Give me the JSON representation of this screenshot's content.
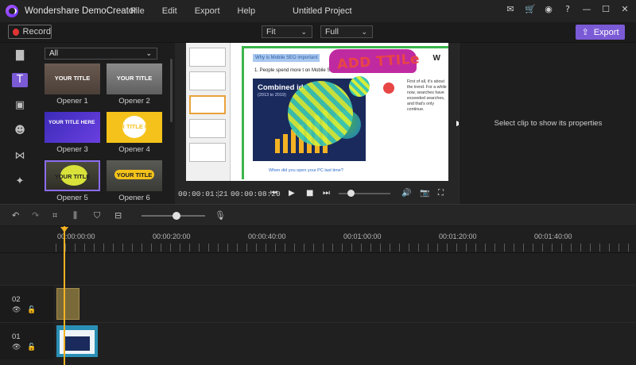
{
  "app": {
    "name": "Wondershare DemoCreator",
    "project_title": "Untitled Project"
  },
  "menu": [
    "File",
    "Edit",
    "Export",
    "Help"
  ],
  "window_icons": [
    "mail-icon",
    "cart-icon",
    "account-icon",
    "help-icon",
    "minimize-icon",
    "maximize-icon",
    "close-icon"
  ],
  "toolbar": {
    "record_label": "Record",
    "fit_value": "Fit",
    "quality_value": "Full",
    "export_label": "Export"
  },
  "colors": {
    "accent": "#7b5ad6",
    "playhead": "#f4b223",
    "record": "#e03434"
  },
  "sidebar_icons": [
    "folder-icon",
    "text-icon",
    "annotation-icon",
    "sticker-icon",
    "transition-icon",
    "effects-icon"
  ],
  "library": {
    "filter_value": "All",
    "items": [
      {
        "label": "Opener 1",
        "thumb_text": "YOUR TITLE"
      },
      {
        "label": "Opener 2",
        "thumb_text": "YOUR TITLE"
      },
      {
        "label": "Opener 3",
        "thumb_text": "YOUR TITLE HERE"
      },
      {
        "label": "Opener 4",
        "thumb_text": "YOUR TITLE HERE"
      },
      {
        "label": "Opener 5",
        "thumb_text": "YOUR TITLE"
      },
      {
        "label": "Opener 6",
        "thumb_text": "YOUR TITLE"
      }
    ]
  },
  "preview": {
    "slide_heading": "Why is Mobile SEO important",
    "slide_bullet": "1.  People spend more t    on Mobile Search",
    "chart_title": "Combined              ide",
    "chart_sub": "(2013 to 2019)",
    "overlay_title": "ADD TTILe",
    "slide_text": "First of all, it's about the trend. For a while now, searches have exceeded searches, and that's only continue.",
    "slide_footer": "When did you open your PC last time?",
    "current_time": "00:00:01:21",
    "total_time": "00:00:08:20"
  },
  "properties": {
    "empty_message": "Select clip to show its properties"
  },
  "timeline": {
    "ruler_labels": [
      "00:00:00:00",
      "00:00:20:00",
      "00:00:40:00",
      "00:01:00:00",
      "00:01:20:00",
      "00:01:40:00"
    ],
    "tracks": [
      {
        "number": "02"
      },
      {
        "number": "01"
      }
    ]
  }
}
